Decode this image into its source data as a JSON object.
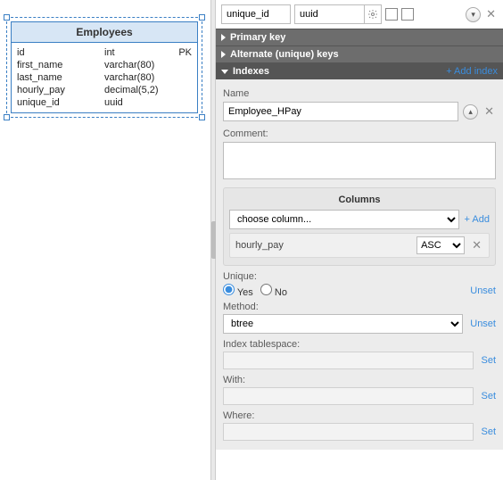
{
  "entity": {
    "title": "Employees",
    "columns": [
      {
        "name": "id",
        "type": "int",
        "pk": "PK"
      },
      {
        "name": "first_name",
        "type": "varchar(80)",
        "pk": ""
      },
      {
        "name": "last_name",
        "type": "varchar(80)",
        "pk": ""
      },
      {
        "name": "hourly_pay",
        "type": "decimal(5,2)",
        "pk": ""
      },
      {
        "name": "unique_id",
        "type": "uuid",
        "pk": ""
      }
    ]
  },
  "field_strip": {
    "name": "unique_id",
    "type": "uuid"
  },
  "sections": {
    "primary_key": "Primary key",
    "alt_keys": "Alternate (unique) keys",
    "indexes": "Indexes",
    "add_index": "+ Add index"
  },
  "index": {
    "name_label": "Name",
    "name_value": "Employee_HPay",
    "comment_label": "Comment:",
    "comment_value": "",
    "columns_title": "Columns",
    "choose_placeholder": "choose column...",
    "add_label": "+ Add",
    "col_name": "hourly_pay",
    "col_order": "ASC",
    "unique_label": "Unique:",
    "yes": "Yes",
    "no": "No",
    "method_label": "Method:",
    "method_value": "btree",
    "tablespace_label": "Index tablespace:",
    "with_label": "With:",
    "where_label": "Where:",
    "unset": "Unset",
    "set": "Set"
  }
}
